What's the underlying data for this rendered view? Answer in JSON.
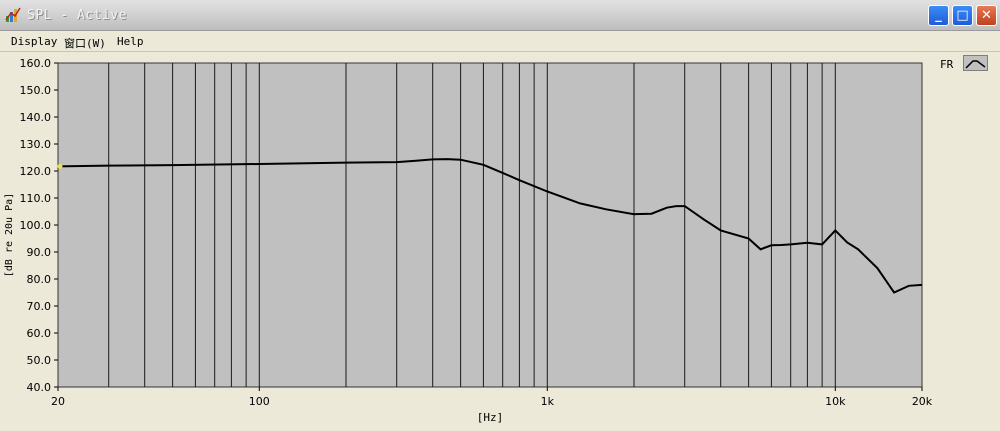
{
  "window": {
    "title": "SPL - Active",
    "minimize_glyph": "_",
    "maximize_glyph": "□",
    "close_glyph": "✕"
  },
  "menu": [
    "Display",
    "窗口(W)",
    "Help"
  ],
  "legend": {
    "label": "FR",
    "icon": "line-swatch-icon"
  },
  "colors": {
    "plot_bg": "#C0C0C0",
    "grid": "#1A1A1A",
    "curve": "#000000",
    "window_bg": "#ECE9D8"
  },
  "chart_data": {
    "type": "line",
    "xlabel": "[Hz]",
    "ylabel": "[dB re 20u Pa]",
    "xscale": "log",
    "xlim": [
      20,
      20000
    ],
    "ylim": [
      40,
      160
    ],
    "grid": true,
    "x_ticks": [
      "20",
      "100",
      "1k",
      "10k",
      "20k"
    ],
    "y_ticks": [
      "40.0",
      "50.0",
      "60.0",
      "70.0",
      "80.0",
      "90.0",
      "100.0",
      "110.0",
      "120.0",
      "130.0",
      "140.0",
      "150.0",
      "160.0"
    ],
    "series": [
      {
        "name": "FR",
        "x": [
          20,
          30,
          50,
          100,
          200,
          300,
          350,
          400,
          450,
          500,
          600,
          700,
          800,
          1000,
          1300,
          1600,
          2000,
          2300,
          2600,
          2800,
          3000,
          3500,
          4000,
          5000,
          5500,
          6000,
          6500,
          7000,
          8000,
          9000,
          10000,
          11000,
          12000,
          14000,
          16000,
          18000,
          20000
        ],
        "y": [
          121.7,
          122,
          122.2,
          122.6,
          123.1,
          123.3,
          123.8,
          124.3,
          124.4,
          124.2,
          122.3,
          119.3,
          116.6,
          112.4,
          108,
          105.8,
          104,
          104.2,
          106.4,
          107,
          107,
          102,
          98,
          95,
          91,
          92.5,
          92.6,
          92.8,
          93.4,
          92.8,
          98,
          93.5,
          91,
          84,
          75,
          77.5,
          77.8
        ]
      }
    ]
  }
}
